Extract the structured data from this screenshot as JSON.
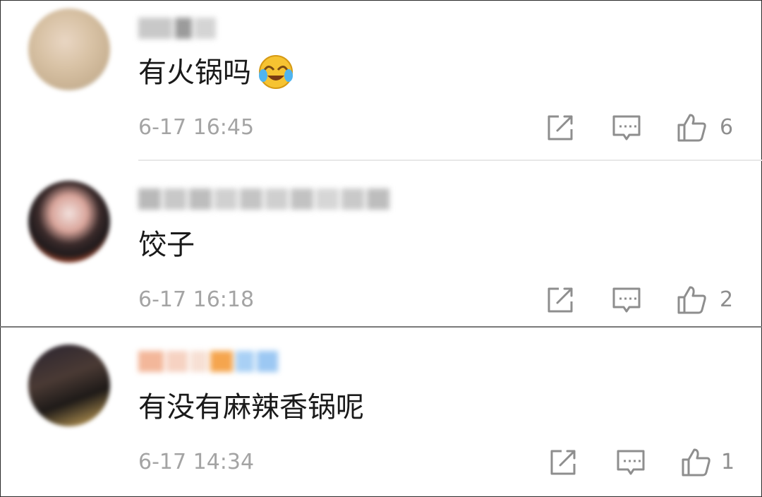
{
  "comments": [
    {
      "text": "有火锅吗",
      "emoji": "laughing-crying-emoji",
      "time": "6-17 16:45",
      "likes": "6"
    },
    {
      "text": "饺子",
      "time": "6-17 16:18",
      "likes": "2"
    },
    {
      "text": "有没有麻辣香锅呢",
      "time": "6-17 14:34",
      "likes": "1"
    }
  ],
  "icons": {
    "share": "share-icon",
    "reply": "comment-icon",
    "like": "thumbs-up-icon"
  },
  "colors": {
    "text": "#1a1a1a",
    "meta": "#a4a4a4",
    "icon": "#8e8e8e"
  }
}
